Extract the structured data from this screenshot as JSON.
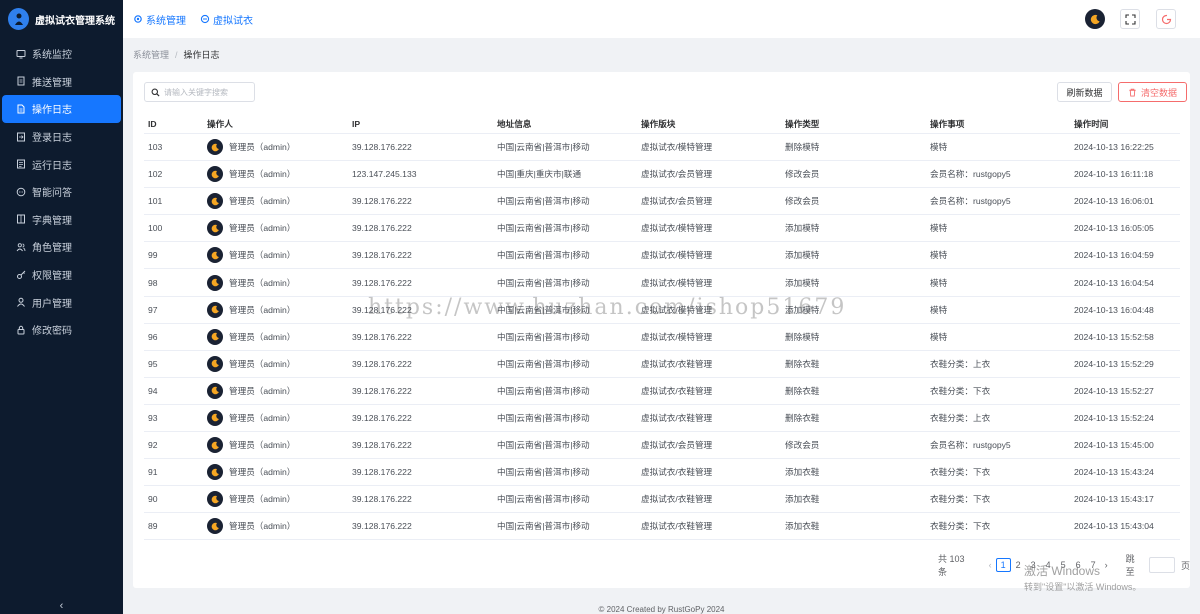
{
  "app": {
    "title": "虚拟试衣管理系统"
  },
  "sidebar": {
    "items": [
      {
        "label": "系统监控",
        "icon": "monitor-icon"
      },
      {
        "label": "推送管理",
        "icon": "document-icon"
      },
      {
        "label": "操作日志",
        "icon": "file-icon",
        "active": true
      },
      {
        "label": "登录日志",
        "icon": "login-icon"
      },
      {
        "label": "运行日志",
        "icon": "log-icon"
      },
      {
        "label": "智能问答",
        "icon": "chat-icon"
      },
      {
        "label": "字典管理",
        "icon": "dictionary-icon"
      },
      {
        "label": "角色管理",
        "icon": "users-icon"
      },
      {
        "label": "权限管理",
        "icon": "key-icon"
      },
      {
        "label": "用户管理",
        "icon": "user-icon"
      },
      {
        "label": "修改密码",
        "icon": "lock-icon"
      }
    ],
    "collapse": "‹"
  },
  "topbar": {
    "tabs": [
      {
        "label": "系统管理",
        "icon": "gear-icon"
      },
      {
        "label": "虚拟试衣",
        "icon": "circle-icon"
      }
    ]
  },
  "breadcrumb": {
    "parent": "系统管理",
    "separator": "/",
    "current": "操作日志"
  },
  "toolbar": {
    "search_placeholder": "请输入关键字搜索",
    "refresh_label": "刷新数据",
    "clear_label": "清空数据"
  },
  "table": {
    "headers": [
      "ID",
      "操作人",
      "IP",
      "地址信息",
      "操作版块",
      "操作类型",
      "操作事项",
      "操作时间"
    ],
    "rows": [
      [
        "103",
        "管理员（admin）",
        "39.128.176.222",
        "中国|云南省|普洱市|移动",
        "虚拟试衣/模特管理",
        "删除模特",
        "模特",
        "2024-10-13 16:22:25"
      ],
      [
        "102",
        "管理员（admin）",
        "123.147.245.133",
        "中国|重庆|重庆市|联通",
        "虚拟试衣/会员管理",
        "修改会员",
        "会员名称：rustgopy5",
        "2024-10-13 16:11:18"
      ],
      [
        "101",
        "管理员（admin）",
        "39.128.176.222",
        "中国|云南省|普洱市|移动",
        "虚拟试衣/会员管理",
        "修改会员",
        "会员名称：rustgopy5",
        "2024-10-13 16:06:01"
      ],
      [
        "100",
        "管理员（admin）",
        "39.128.176.222",
        "中国|云南省|普洱市|移动",
        "虚拟试衣/模特管理",
        "添加模特",
        "模特",
        "2024-10-13 16:05:05"
      ],
      [
        "99",
        "管理员（admin）",
        "39.128.176.222",
        "中国|云南省|普洱市|移动",
        "虚拟试衣/模特管理",
        "添加模特",
        "模特",
        "2024-10-13 16:04:59"
      ],
      [
        "98",
        "管理员（admin）",
        "39.128.176.222",
        "中国|云南省|普洱市|移动",
        "虚拟试衣/模特管理",
        "添加模特",
        "模特",
        "2024-10-13 16:04:54"
      ],
      [
        "97",
        "管理员（admin）",
        "39.128.176.222",
        "中国|云南省|普洱市|移动",
        "虚拟试衣/模特管理",
        "添加模特",
        "模特",
        "2024-10-13 16:04:48"
      ],
      [
        "96",
        "管理员（admin）",
        "39.128.176.222",
        "中国|云南省|普洱市|移动",
        "虚拟试衣/模特管理",
        "删除模特",
        "模特",
        "2024-10-13 15:52:58"
      ],
      [
        "95",
        "管理员（admin）",
        "39.128.176.222",
        "中国|云南省|普洱市|移动",
        "虚拟试衣/衣鞋管理",
        "删除衣鞋",
        "衣鞋分类：上衣",
        "2024-10-13 15:52:29"
      ],
      [
        "94",
        "管理员（admin）",
        "39.128.176.222",
        "中国|云南省|普洱市|移动",
        "虚拟试衣/衣鞋管理",
        "删除衣鞋",
        "衣鞋分类：下衣",
        "2024-10-13 15:52:27"
      ],
      [
        "93",
        "管理员（admin）",
        "39.128.176.222",
        "中国|云南省|普洱市|移动",
        "虚拟试衣/衣鞋管理",
        "删除衣鞋",
        "衣鞋分类：上衣",
        "2024-10-13 15:52:24"
      ],
      [
        "92",
        "管理员（admin）",
        "39.128.176.222",
        "中国|云南省|普洱市|移动",
        "虚拟试衣/会员管理",
        "修改会员",
        "会员名称：rustgopy5",
        "2024-10-13 15:45:00"
      ],
      [
        "91",
        "管理员（admin）",
        "39.128.176.222",
        "中国|云南省|普洱市|移动",
        "虚拟试衣/衣鞋管理",
        "添加衣鞋",
        "衣鞋分类：下衣",
        "2024-10-13 15:43:24"
      ],
      [
        "90",
        "管理员（admin）",
        "39.128.176.222",
        "中国|云南省|普洱市|移动",
        "虚拟试衣/衣鞋管理",
        "添加衣鞋",
        "衣鞋分类：下衣",
        "2024-10-13 15:43:17"
      ],
      [
        "89",
        "管理员（admin）",
        "39.128.176.222",
        "中国|云南省|普洱市|移动",
        "虚拟试衣/衣鞋管理",
        "添加衣鞋",
        "衣鞋分类：下衣",
        "2024-10-13 15:43:04"
      ]
    ]
  },
  "pagination": {
    "total": "共 103 条",
    "prev": "‹",
    "pages": [
      "1",
      "2",
      "3",
      "4",
      "5",
      "6",
      "7"
    ],
    "current": "1",
    "next": "›",
    "jump_label": "跳至",
    "page_suffix": "页"
  },
  "footer": {
    "text": "© 2024 Created by RustGoPy 2024"
  },
  "watermark": {
    "url": "https://www.huzhan.com/ishop51679",
    "activate_line1": "激活 Windows",
    "activate_line2": "转到\"设置\"以激活 Windows。"
  },
  "colors": {
    "accent": "#1677ff",
    "sidebar_bg": "#0d1b2e",
    "danger": "#f56c6c"
  }
}
